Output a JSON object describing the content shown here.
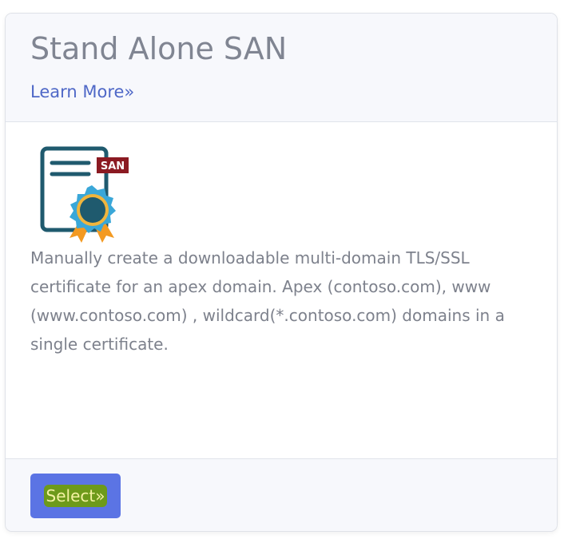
{
  "card": {
    "title": "Stand Alone SAN",
    "learn_more_label": "Learn More»",
    "badge_text": "SAN",
    "description": "Manually create a downloadable multi-domain TLS/SSL certificate for an apex domain. Apex (contoso.com), www (www.contoso.com) , wildcard(*.contoso.com) domains in a single certificate.",
    "select_label": "Select»",
    "icon": "certificate-icon"
  },
  "colors": {
    "header_bg": "#f7f8fc",
    "title": "#808592",
    "link": "#4f68c7",
    "body_text": "#7d818c",
    "button_bg": "#5b74e4",
    "button_highlight": "#6d9a1a",
    "button_text": "#f4f2a2",
    "badge_bg": "#8b1a22",
    "cert_outline": "#1f5a6e"
  }
}
